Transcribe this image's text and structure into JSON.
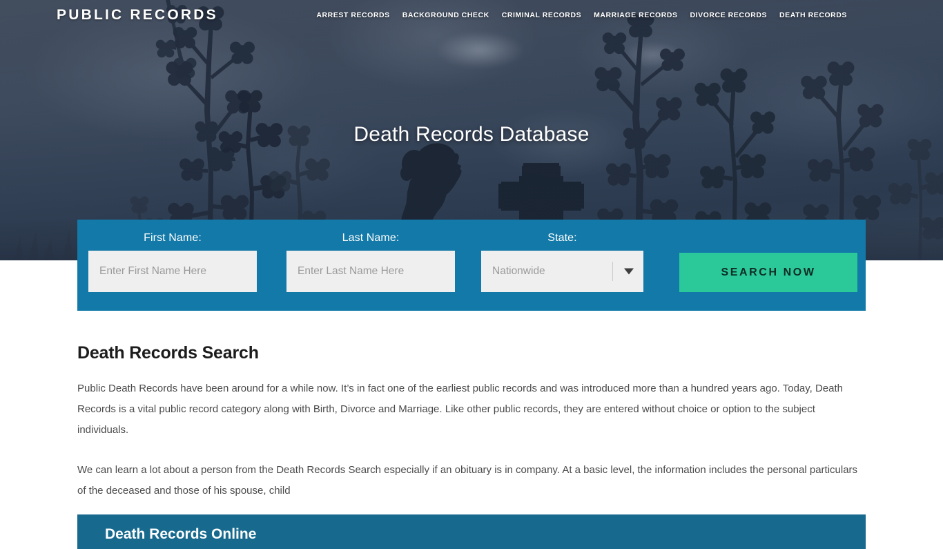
{
  "header": {
    "brand": "PUBLIC RECORDS",
    "nav": [
      {
        "label": "ARREST RECORDS"
      },
      {
        "label": "BACKGROUND CHECK"
      },
      {
        "label": "CRIMINAL RECORDS"
      },
      {
        "label": "MARRIAGE RECORDS"
      },
      {
        "label": "DIVORCE RECORDS"
      },
      {
        "label": "DEATH RECORDS"
      }
    ]
  },
  "hero": {
    "title": "Death Records Database",
    "imagery": [
      "praying-girl-silhouette",
      "cross-gravestone-silhouette",
      "flower-branch-silhouettes",
      "dusk-sky"
    ]
  },
  "search": {
    "first_name_label": "First Name:",
    "first_name_placeholder": "Enter First Name Here",
    "first_name_value": "",
    "last_name_label": "Last Name:",
    "last_name_placeholder": "Enter Last Name Here",
    "last_name_value": "",
    "state_label": "State:",
    "state_selected": "Nationwide",
    "state_options": [
      "Nationwide"
    ],
    "submit_label": "SEARCH NOW",
    "bar_color": "#1379a8",
    "button_color": "#2bc99a"
  },
  "main": {
    "heading": "Death Records Search",
    "paragraph_1": "Public Death Records have been around for a while now. It’s in fact one of the earliest public records and was introduced more than a hundred years ago. Today, Death Records is a vital public record category along with Birth, Divorce and Marriage. Like other public records, they are entered without choice or option to the subject individuals.",
    "paragraph_2": "We can learn a lot about a person from the Death Records Search especially if an obituary is in company. At a basic level, the information includes the personal particulars of the deceased and those of his spouse, child"
  },
  "bottom_banner": {
    "title": "Death Records Online",
    "color": "#176a8e"
  }
}
